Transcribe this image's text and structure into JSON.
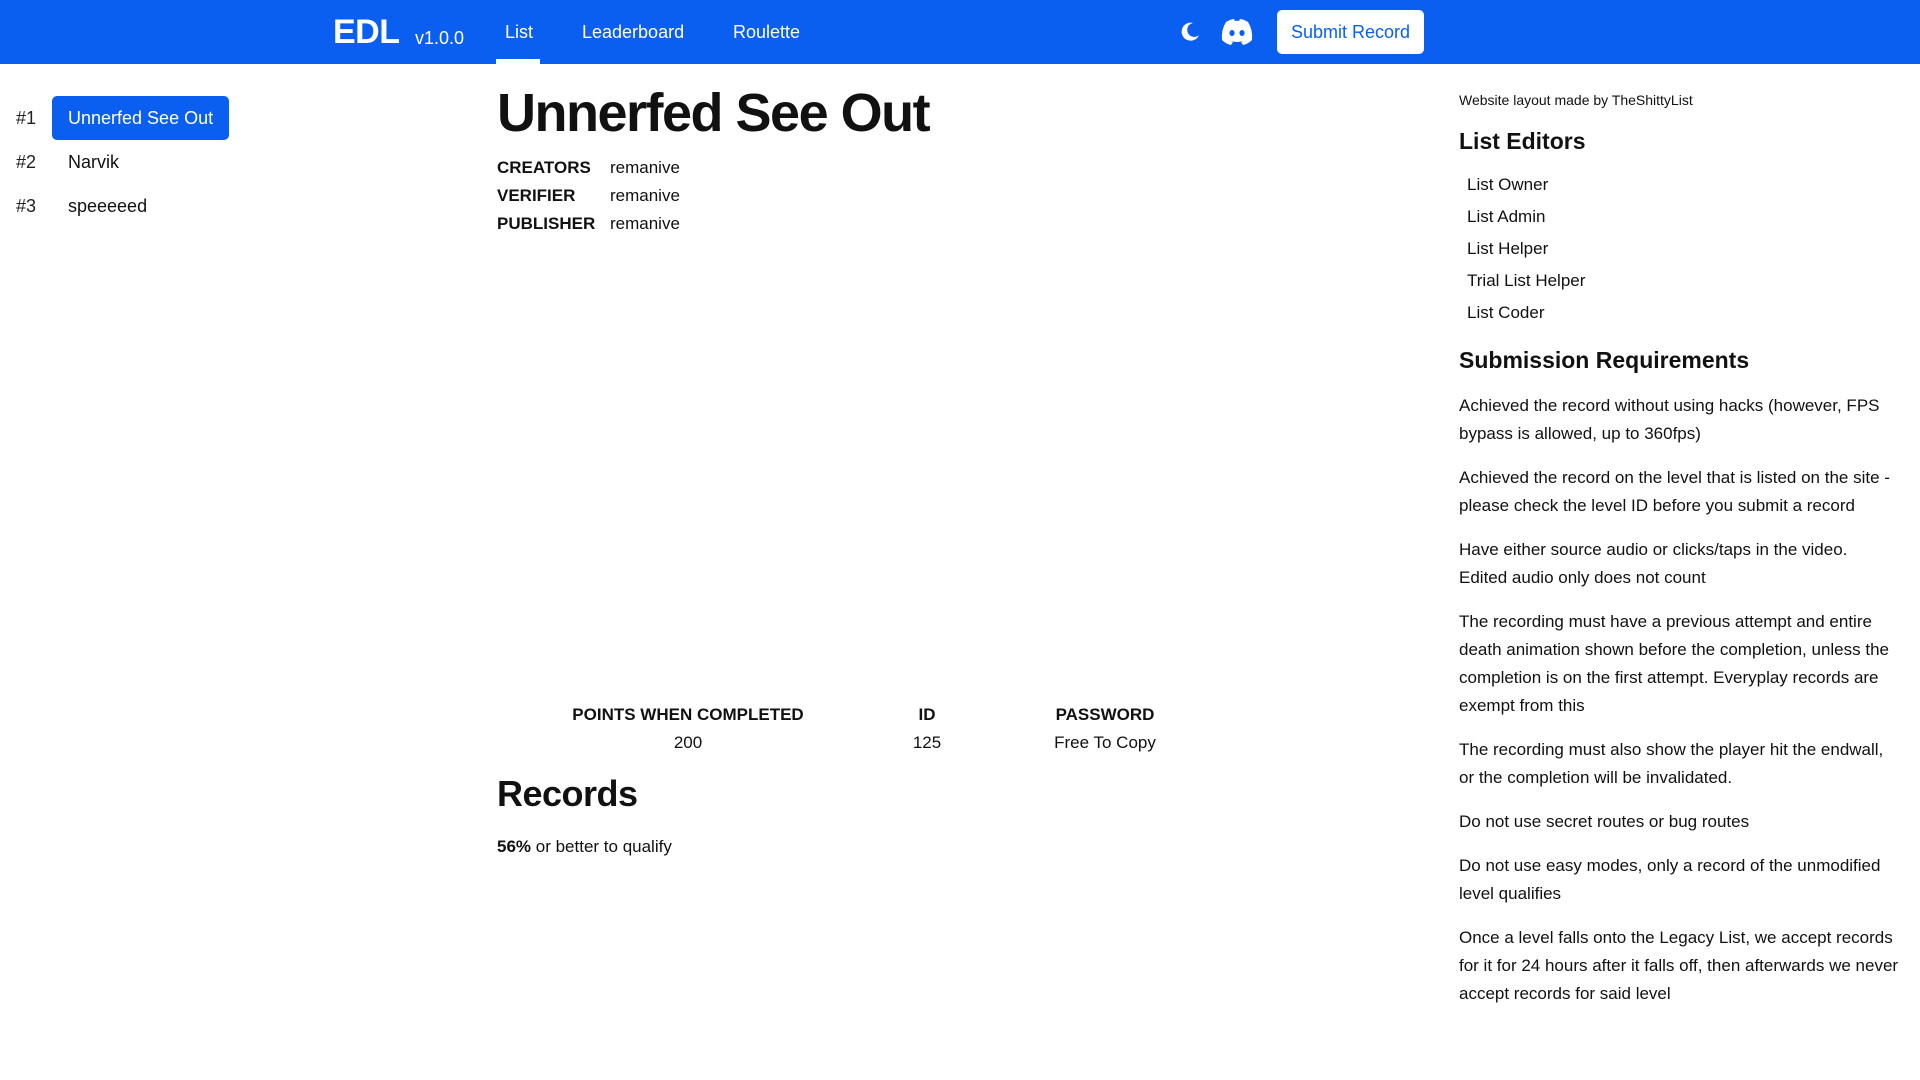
{
  "header": {
    "brand": "EDL",
    "version": "v1.0.0",
    "nav": [
      {
        "label": "List",
        "active": true
      },
      {
        "label": "Leaderboard",
        "active": false
      },
      {
        "label": "Roulette",
        "active": false
      }
    ],
    "icons": [
      "moon-icon",
      "discord-icon"
    ],
    "submit_label": "Submit Record",
    "accent_color": "#0a5ff0"
  },
  "sidebar": {
    "levels": [
      {
        "rank": "#1",
        "name": "Unnerfed See Out",
        "active": true
      },
      {
        "rank": "#2",
        "name": "Narvik",
        "active": false
      },
      {
        "rank": "#3",
        "name": "speeeeed",
        "active": false
      }
    ]
  },
  "level": {
    "title": "Unnerfed See Out",
    "meta": [
      {
        "key": "CREATORS",
        "value": "remanive"
      },
      {
        "key": "VERIFIER",
        "value": "remanive"
      },
      {
        "key": "PUBLISHER",
        "value": "remanive"
      }
    ],
    "stats": [
      {
        "label": "POINTS WHEN COMPLETED",
        "value": "200"
      },
      {
        "label": "ID",
        "value": "125"
      },
      {
        "label": "PASSWORD",
        "value": "Free To Copy"
      }
    ],
    "records_title": "Records",
    "qualify_percent": "56%",
    "qualify_text": " or better to qualify"
  },
  "right_panel": {
    "credit": "Website layout made by TheShittyList",
    "editors_title": "List Editors",
    "editors": [
      "List Owner",
      "List Admin",
      "List Helper",
      "Trial List Helper",
      "List Coder"
    ],
    "requirements_title": "Submission Requirements",
    "requirements": [
      "Achieved the record without using hacks (however, FPS bypass is allowed, up to 360fps)",
      "Achieved the record on the level that is listed on the site - please check the level ID before you submit a record",
      "Have either source audio or clicks/taps in the video. Edited audio only does not count",
      "The recording must have a previous attempt and entire death animation shown before the completion, unless the completion is on the first attempt. Everyplay records are exempt from this",
      "The recording must also show the player hit the endwall, or the completion will be invalidated.",
      "Do not use secret routes or bug routes",
      "Do not use easy modes, only a record of the unmodified level qualifies",
      "Once a level falls onto the Legacy List, we accept records for it for 24 hours after it falls off, then afterwards we never accept records for said level"
    ]
  }
}
